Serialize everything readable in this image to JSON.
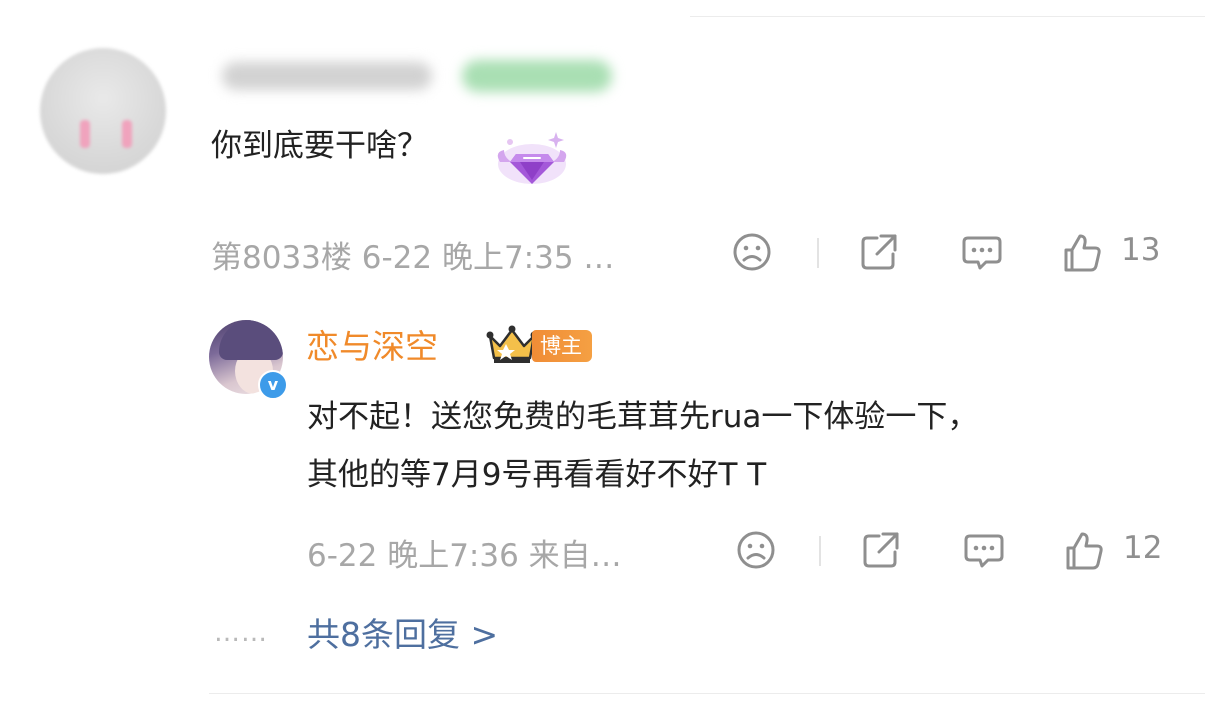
{
  "comment": {
    "text": "你到底要干啥？",
    "meta": "第8033楼 6-22 晚上7:35 …",
    "like_count": "13",
    "icons": {
      "dislike": "sad-face-icon",
      "share": "share-icon",
      "comment": "comment-icon",
      "like": "thumbs-up-icon",
      "badge": "diamond-badge-icon"
    }
  },
  "reply": {
    "author": "恋与深空",
    "role_badge": "博主",
    "verified_mark": "v",
    "text_lines": [
      "对不起！送您免费的毛茸茸先rua一下体验一下，",
      "其他的等7月9号再看看好不好T T"
    ],
    "meta": "6-22 晚上7:36 来自…",
    "like_count": "12",
    "icons": {
      "crown": "crown-icon",
      "verified": "verified-icon"
    }
  },
  "more_replies": {
    "dots": "……",
    "label": "共8条回复 >"
  },
  "colors": {
    "accent_name": "#f08a2a",
    "link": "#4e6f9f",
    "meta_text": "#a7a7a7",
    "verified": "#3d9be9",
    "badge_bg": "#f5a043"
  }
}
